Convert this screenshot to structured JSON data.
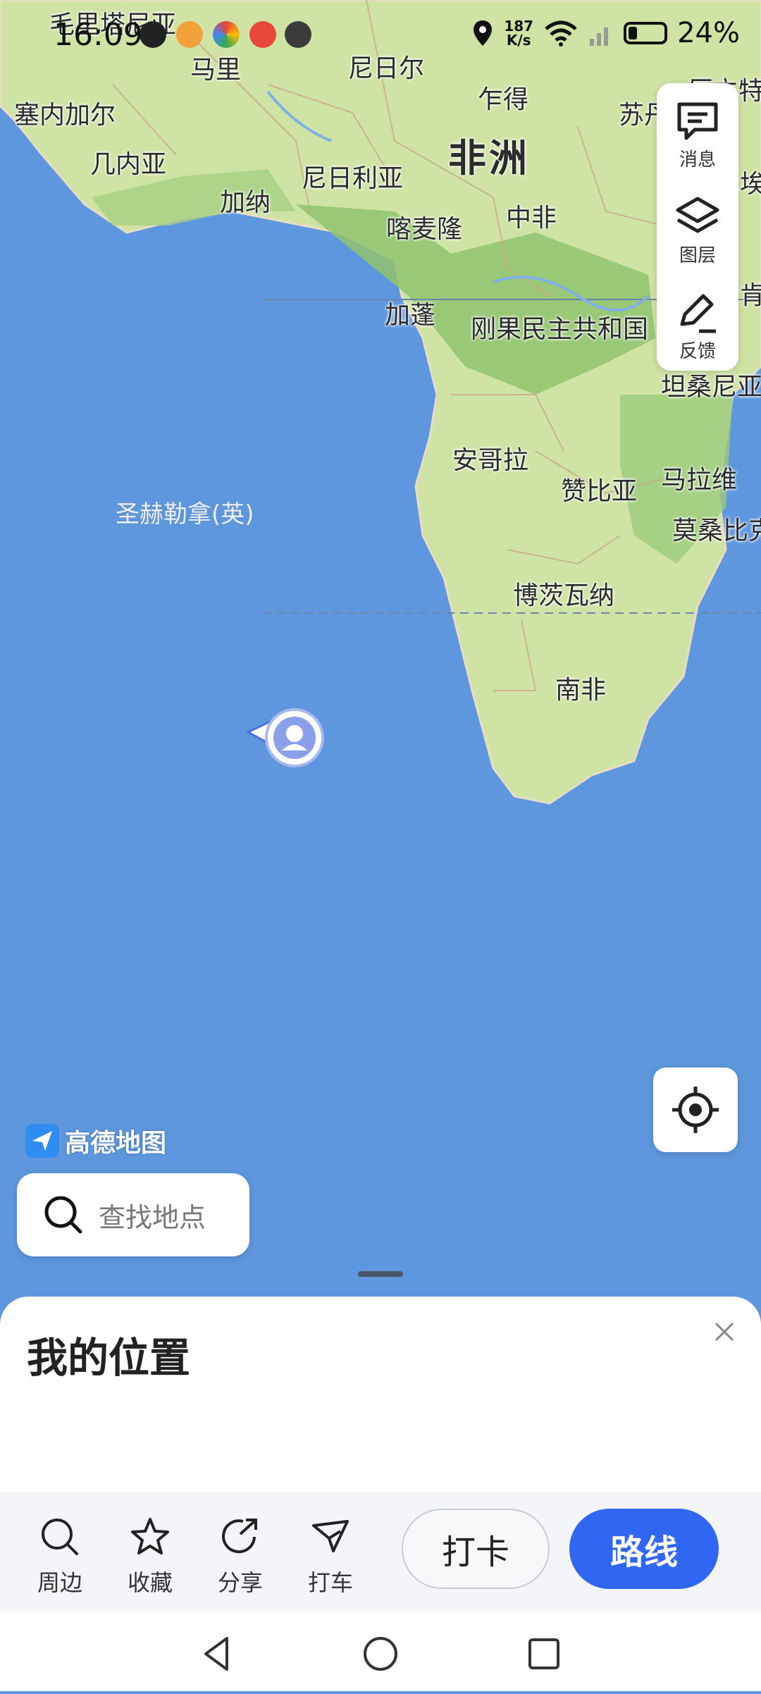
{
  "status_bar": {
    "time": "16:09",
    "net_speed_value": "187",
    "net_speed_unit": "K/s",
    "battery": "24%"
  },
  "map": {
    "labels": {
      "mauritania": "毛里塔尼亚",
      "mali": "马里",
      "niger": "尼日尔",
      "chad": "乍得",
      "sudan": "苏丹",
      "senegal": "塞内加尔",
      "guinea": "几内亚",
      "continent": "非洲",
      "nigeria": "尼日利亚",
      "ghana": "加纳",
      "cameroon": "喀麦隆",
      "car": "中非",
      "gabon": "加蓬",
      "drc": "刚果民主共和国",
      "tanzania": "坦桑尼亚",
      "angola": "安哥拉",
      "zambia": "赞比亚",
      "malawi": "马拉维",
      "mozambique": "莫桑比克",
      "botswana": "博茨瓦纳",
      "south_africa": "南非",
      "st_helena": "圣赫勒拿(英)",
      "ethiopia_partial": "埃",
      "eritrea_partial": "厄立特",
      "kenya_partial": "肯尼"
    },
    "brand": "高德地图",
    "colors": {
      "ocean": "#5e97dd",
      "land": "#cfe3a4",
      "forest": "#8fc36e",
      "accent": "#2f66f2"
    }
  },
  "side_panel": {
    "messages": "消息",
    "layers": "图层",
    "feedback": "反馈"
  },
  "search": {
    "placeholder": "查找地点"
  },
  "sheet": {
    "title": "我的位置",
    "actions": {
      "nearby": "周边",
      "favorite": "收藏",
      "share": "分享",
      "taxi": "打车"
    },
    "checkin": "打卡",
    "route": "路线"
  }
}
